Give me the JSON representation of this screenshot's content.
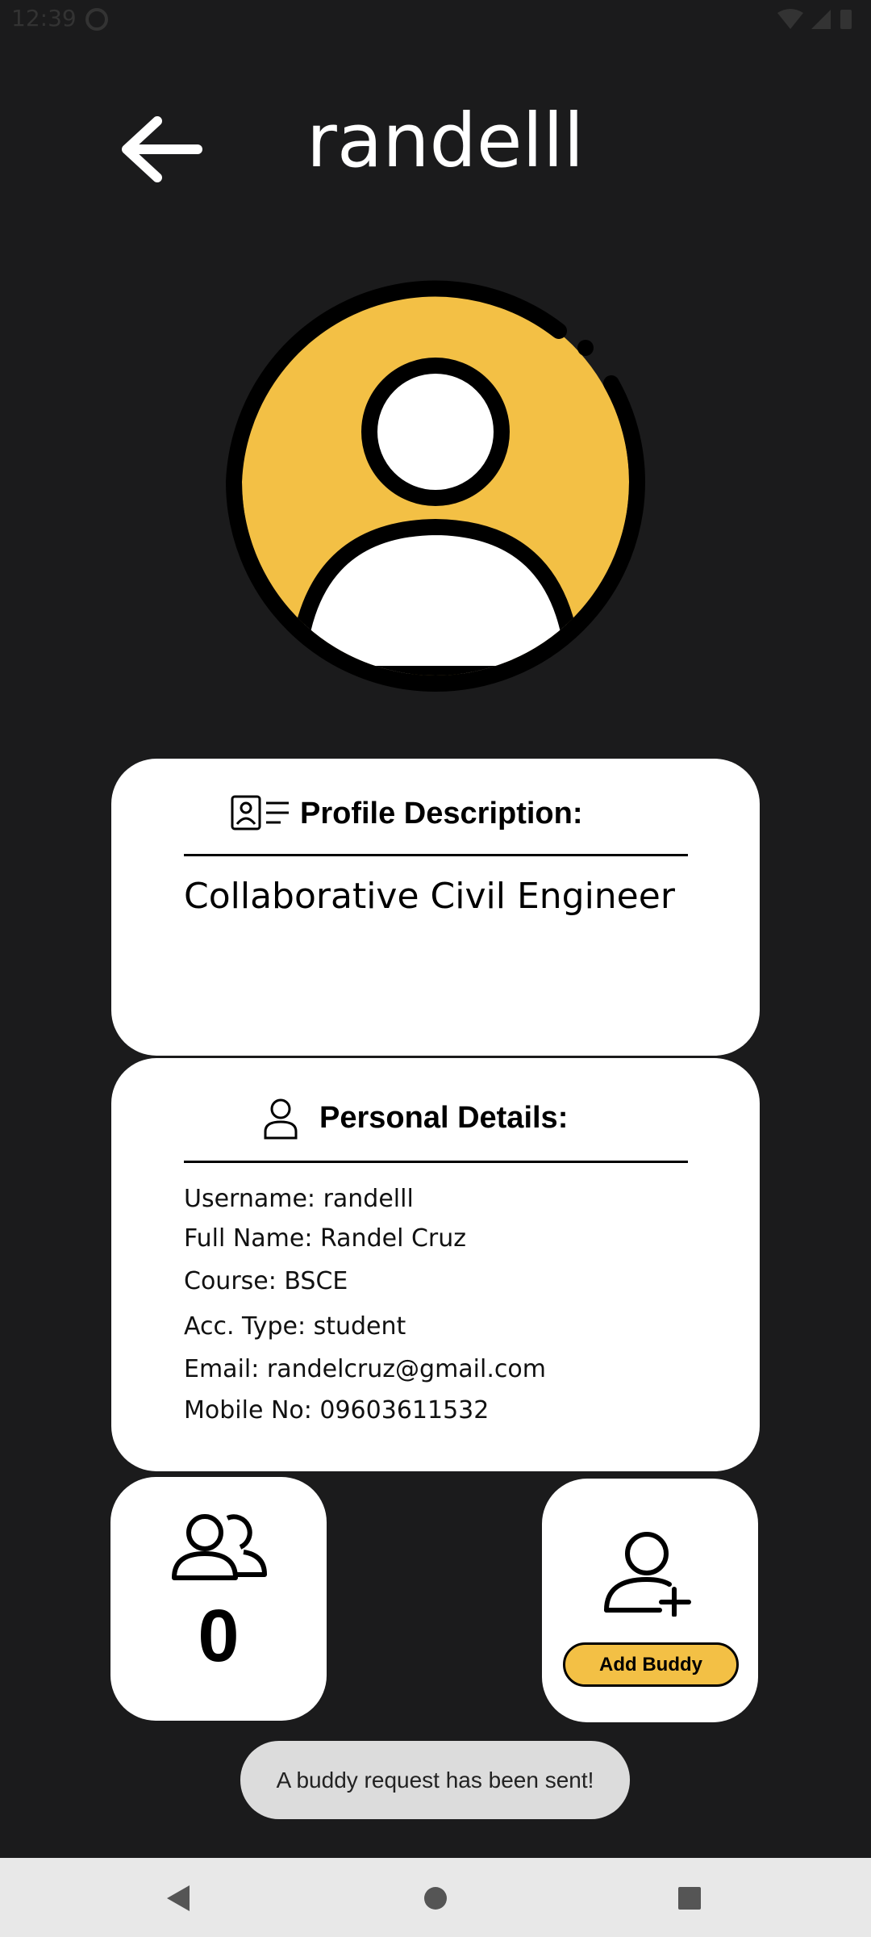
{
  "status_bar": {
    "time": "12:39"
  },
  "header": {
    "title": "randelll"
  },
  "profile_description": {
    "heading": "Profile Description:",
    "text": "Collaborative Civil Engineer"
  },
  "personal_details": {
    "heading": "Personal Details:",
    "lines": [
      "Username: randelll",
      "Full Name: Randel Cruz",
      "Course: BSCE",
      "Acc. Type: student",
      "Email: randelcruz@gmail.com",
      "Mobile No: 09603611532"
    ]
  },
  "buddies": {
    "count": "0"
  },
  "add_buddy": {
    "label": "Add Buddy"
  },
  "toast": {
    "message": "A buddy request has been sent!"
  },
  "colors": {
    "background": "#1b1b1c",
    "accent": "#f3c045",
    "card": "#ffffff"
  },
  "icons": {
    "back": "arrow-left-icon",
    "avatar": "user-avatar-icon",
    "description": "id-card-icon",
    "details": "user-icon",
    "buddies": "users-icon",
    "add": "user-plus-icon"
  }
}
